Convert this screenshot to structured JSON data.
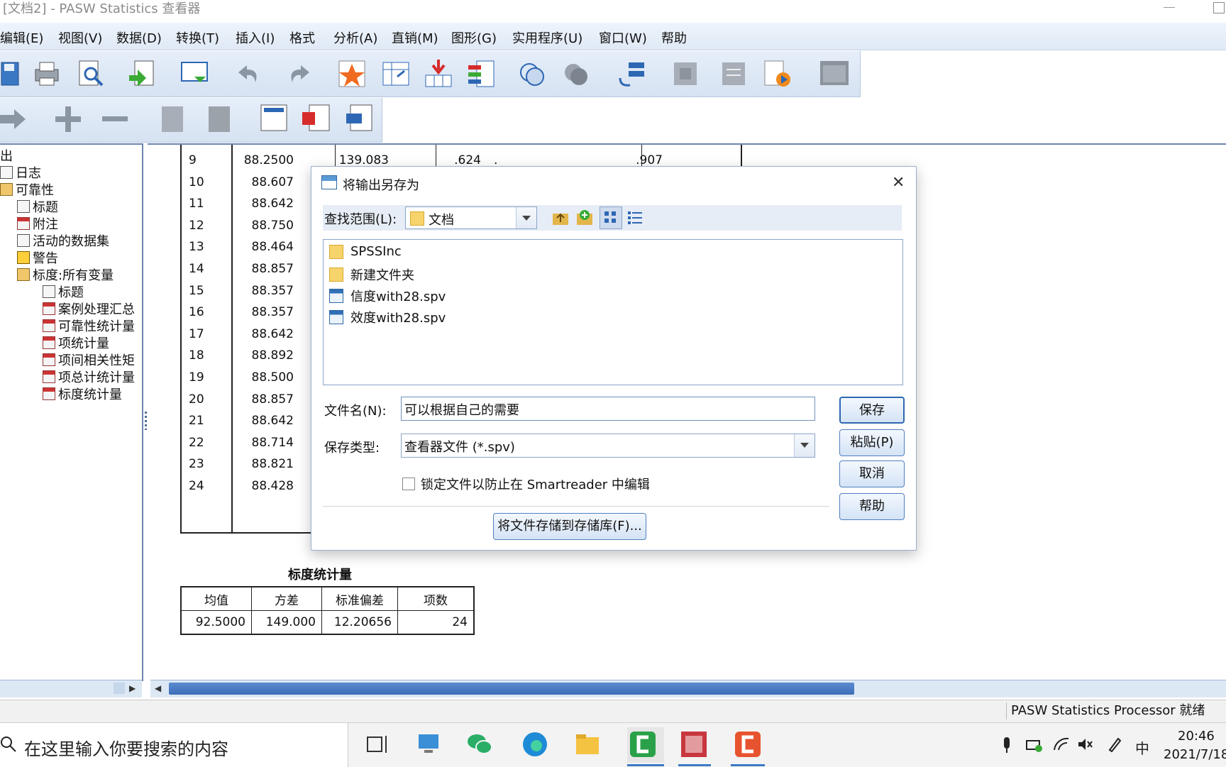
{
  "window": {
    "title": "[文档2] - PASW Statistics 查看器"
  },
  "menubar": {
    "items": [
      "编辑(E)",
      "视图(V)",
      "数据(D)",
      "转换(T)",
      "插入(I)",
      "格式",
      "分析(A)",
      "直销(M)",
      "图形(G)",
      "实用程序(U)",
      "窗口(W)",
      "帮助"
    ]
  },
  "tree": {
    "items": [
      "出",
      "日志",
      "可靠性",
      "标题",
      "附注",
      "活动的数据集",
      "警告",
      "标度:所有变量",
      "标题",
      "案例处理汇总",
      "可靠性统计量",
      "项统计量",
      "项间相关性矩",
      "项总计统计量",
      "标度统计量"
    ]
  },
  "output_table": {
    "rows": [
      {
        "n": "9",
        "c1": "88.2500",
        "c2": "139.083",
        "c3": ".624",
        "c4": ".",
        "c5": ".907"
      },
      {
        "n": "10",
        "c1": "88.607"
      },
      {
        "n": "11",
        "c1": "88.642"
      },
      {
        "n": "12",
        "c1": "88.750"
      },
      {
        "n": "13",
        "c1": "88.464"
      },
      {
        "n": "14",
        "c1": "88.857"
      },
      {
        "n": "15",
        "c1": "88.357"
      },
      {
        "n": "16",
        "c1": "88.357"
      },
      {
        "n": "17",
        "c1": "88.642"
      },
      {
        "n": "18",
        "c1": "88.892"
      },
      {
        "n": "19",
        "c1": "88.500"
      },
      {
        "n": "20",
        "c1": "88.857"
      },
      {
        "n": "21",
        "c1": "88.642"
      },
      {
        "n": "22",
        "c1": "88.714"
      },
      {
        "n": "23",
        "c1": "88.821"
      },
      {
        "n": "24",
        "c1": "88.428"
      }
    ]
  },
  "scale_stats": {
    "title": "标度统计量",
    "headers": [
      "均值",
      "方差",
      "标准偏差",
      "项数"
    ],
    "values": [
      "92.5000",
      "149.000",
      "12.20656",
      "24"
    ]
  },
  "dialog": {
    "title": "将输出另存为",
    "look_in_label": "查找范围(L):",
    "look_in_value": "文档",
    "files": [
      {
        "name": "SPSSInc",
        "type": "folder"
      },
      {
        "name": "新建文件夹",
        "type": "folder"
      },
      {
        "name": "信度with28.spv",
        "type": "spv"
      },
      {
        "name": "效度with28.spv",
        "type": "spv"
      }
    ],
    "filename_label": "文件名(N):",
    "filename_value": "可以根据自己的需要",
    "type_label": "保存类型:",
    "type_value": "查看器文件 (*.spv)",
    "lock_label": "锁定文件以防止在 Smartreader 中编辑",
    "repo_button": "将文件存储到存储库(F)...",
    "buttons": {
      "save": "保存",
      "paste": "粘贴(P)",
      "cancel": "取消",
      "help": "帮助"
    }
  },
  "statusbar": {
    "text": "PASW Statistics Processor 就绪"
  },
  "taskbar": {
    "search_placeholder": "在这里输入你要搜索的内容",
    "time": "20:46",
    "date": "2021/7/18",
    "ime": "中"
  },
  "colors": {
    "accent": "#2d67b3",
    "toolbar": "#dfe9f5",
    "scroll_thumb": "#3c6db8"
  }
}
